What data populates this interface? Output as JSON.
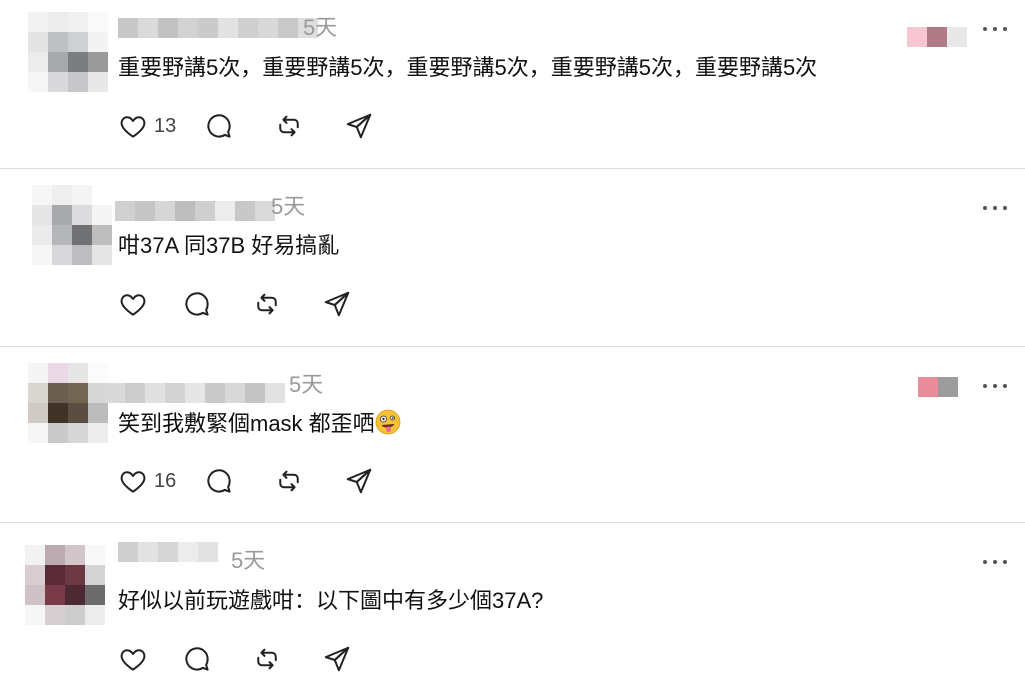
{
  "posts": [
    {
      "time": "5天",
      "text": "重要野講5次，重要野講5次，重要野講5次，重要野講5次，重要野講5次",
      "likes": "13",
      "has_thumb": true
    },
    {
      "time": "5天",
      "text": "咁37A 同37B 好易搞亂",
      "likes": "",
      "has_thumb": false
    },
    {
      "time": "5天",
      "text": "笑到我敷緊個mask 都歪哂",
      "emoji": "zany-face",
      "likes": "16",
      "has_thumb": true
    },
    {
      "time": "5天",
      "text": "好似以前玩遊戲咁：以下圖中有多少個37A?",
      "likes": "",
      "has_thumb": false
    }
  ],
  "icons": {
    "like": "heart-icon",
    "reply": "comment-icon",
    "repost": "repost-icon",
    "share": "share-icon",
    "more": "more-icon"
  }
}
